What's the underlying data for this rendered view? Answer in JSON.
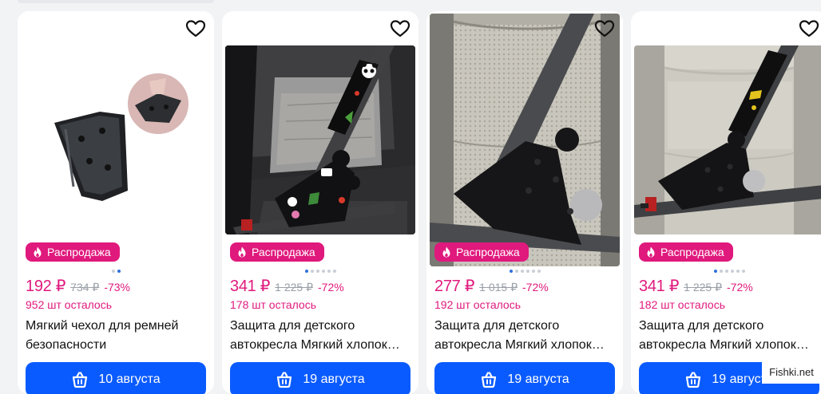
{
  "colors": {
    "accent_pink": "#e0197d",
    "button_blue": "#0a5bff",
    "old_price_gray": "#9aa0a8",
    "page_bg": "#f2f3f5"
  },
  "icons": {
    "favorite": "heart-outline-icon",
    "sale": "flame-icon",
    "delivery": "basket-icon"
  },
  "products": [
    {
      "badge": "Распродажа",
      "price": "192 ₽",
      "old_price": "734 ₽",
      "discount": "-73%",
      "stock": "952 шт осталось",
      "title": "Мягкий чехол для ремней безопасности",
      "delivery": "10 августа",
      "gallery_dots": 2,
      "gallery_active": 1
    },
    {
      "badge": "Распродажа",
      "price": "341 ₽",
      "old_price": "1 225 ₽",
      "discount": "-72%",
      "stock": "178 шт осталось",
      "title": "Защита для детского автокресла Мягкий хлопок…",
      "delivery": "19 августа",
      "gallery_dots": 6,
      "gallery_active": 0
    },
    {
      "badge": "Распродажа",
      "price": "277 ₽",
      "old_price": "1 015 ₽",
      "discount": "-72%",
      "stock": "192 шт осталось",
      "title": "Защита для детского автокресла Мягкий хлопок…",
      "delivery": "19 августа",
      "gallery_dots": 6,
      "gallery_active": 0
    },
    {
      "badge": "Распродажа",
      "price": "341 ₽",
      "old_price": "1 225 ₽",
      "discount": "-72%",
      "stock": "182 шт осталось",
      "title": "Защита для детского автокресла Мягкий хлопок…",
      "delivery": "19 августа",
      "gallery_dots": 6,
      "gallery_active": 0
    }
  ],
  "watermark": "Fishki.net"
}
